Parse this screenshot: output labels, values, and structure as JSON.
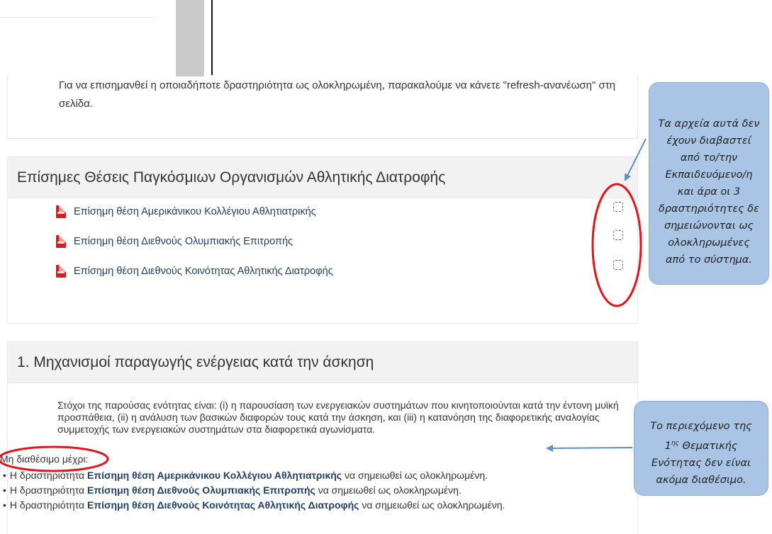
{
  "notice": {
    "text": "Για να επισημανθεί η οποιαδήποτε δραστηριότητα ως ολοκληρωμένη, παρακαλούμε να κάνετε \"refresh-ανανέωση\" στη σελίδα."
  },
  "section": {
    "title": "Επίσημες Θέσεις Παγκόσμιων Οργανισμών Αθλητικής Διατροφής",
    "activities": [
      {
        "label": "Επίσημη θέση Αμερικάνικου Κολλέγιου Αθλητιατρικής",
        "icon": "pdf-icon",
        "completed": false
      },
      {
        "label": "Επίσημη θέση Διεθνούς Ολυμπιακής Επιτροπής",
        "icon": "pdf-icon",
        "completed": false
      },
      {
        "label": "Επίσημη θέση Διεθνούς Κοινότητας Αθλητικής Διατροφής",
        "icon": "pdf-icon",
        "completed": false
      }
    ]
  },
  "unit": {
    "title": "1. Μηχανισμοί παραγωγής ενέργειας κατά την άσκηση",
    "description": "Στόχοι της παρούσας ενότητας είναι: (i) η παρουσίαση των ενεργειακών συστημάτων που κινητοποιούνται κατά την έντονη μυϊκή προσπάθεια, (ii) η ανάλυση των βασικών διαφορών τους κατά την άσκηση, και (iii) η κατανόηση της διαφορετικής αναλογίας συμμετοχής των ενεργειακών συστημάτων στα διαφορετικά αγωνίσματα.",
    "availability_label": "Μη διαθέσιμο μέχρι:",
    "requirements": [
      {
        "prefix": "Η δραστηριότητα",
        "activity": "Επίσημη θέση Αμερικάνικου Κολλέγιου Αθλητιατρικής",
        "suffix": "να σημειωθεί ως ολοκληρωμένη."
      },
      {
        "prefix": "Η δραστηριότητα",
        "activity": "Επίσημη θέση Διεθνούς Ολυμπιακής Επιτροπής",
        "suffix": "να σημειωθεί ως ολοκληρωμένη."
      },
      {
        "prefix": "Η δραστηριότητα",
        "activity": "Επίσημη θέση Διεθνούς Κοινότητας Αθλητικής Διατροφής",
        "suffix": "να σημειωθεί ως ολοκληρωμένη."
      }
    ]
  },
  "callouts": {
    "first": {
      "lines": [
        "Τα αρχεία αυτά δεν",
        "έχουν διαβαστεί",
        "από το/την",
        "Εκπαιδευόμενο/η",
        "και άρα οι 3",
        "δραστηριότητες δε",
        "σημειώνονται ως",
        "ολοκληρωμένες",
        "από το σύστημα."
      ]
    },
    "second": {
      "line1": "Το περιεχόμενο της",
      "line2_num": "1",
      "line2_sup": "ης",
      "line2_rest": "Θεματικής",
      "line3": "Ενότητας δεν είναι",
      "line4": "ακόμα διαθέσιμο."
    }
  },
  "colors": {
    "annotation_red": "#e3141c",
    "callout_fill": "#a9c4e4",
    "arrow_blue": "#5b8fd1",
    "link": "#1f3f6b"
  }
}
